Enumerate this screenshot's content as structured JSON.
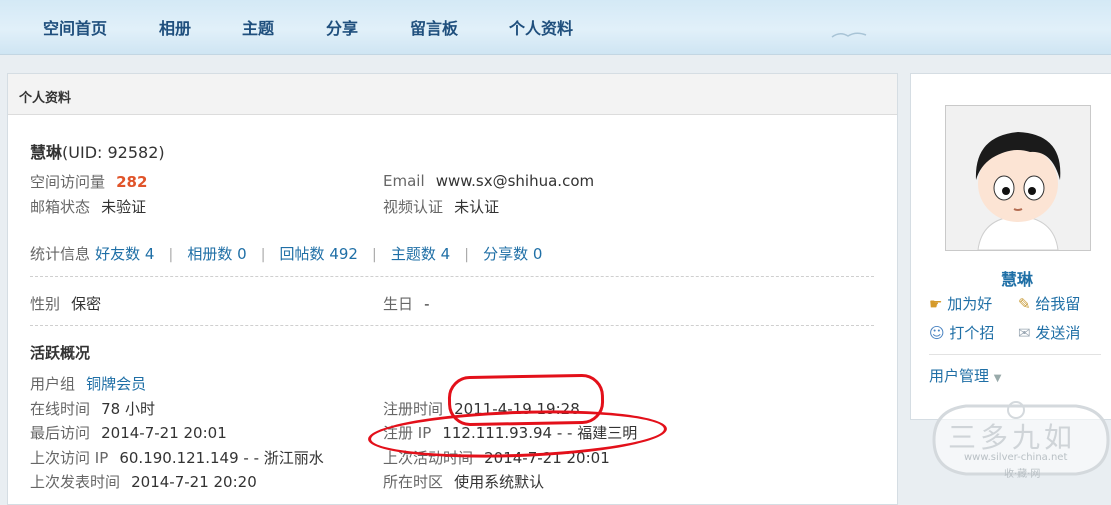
{
  "nav": {
    "items": [
      "空间首页",
      "相册",
      "主题",
      "分享",
      "留言板",
      "个人资料"
    ]
  },
  "panel": {
    "title": "个人资料"
  },
  "profile": {
    "name": "慧琳",
    "uid_text": "(UID: 92582)",
    "visits_label": "空间访问量",
    "visits_value": "282",
    "email_status_label": "邮箱状态",
    "email_status_value": "未验证",
    "email_label": "Email",
    "email_value": "www.sx@shihua.com",
    "video_label": "视频认证",
    "video_value": "未认证"
  },
  "stats": {
    "label": "统计信息",
    "items": [
      "好友数 4",
      "相册数 0",
      "回帖数 492",
      "主题数 4",
      "分享数 0"
    ]
  },
  "basic": {
    "gender_label": "性别",
    "gender_value": "保密",
    "birthday_label": "生日",
    "birthday_value": "-"
  },
  "activity": {
    "title": "活跃概况",
    "group_label": "用户组",
    "group_value": "铜牌会员",
    "online_label": "在线时间",
    "online_value": "78 小时",
    "last_visit_label": "最后访问",
    "last_visit_value": "2014-7-21 20:01",
    "last_ip_label": "上次访问 IP",
    "last_ip_value": "60.190.121.149 - - 浙江丽水",
    "last_post_label": "上次发表时间",
    "last_post_value": "2014-7-21 20:20",
    "reg_time_label": "注册时间",
    "reg_time_value": "2011-4-19 19:28",
    "reg_ip_label": "注册 IP",
    "reg_ip_value": "112.111.93.94 - - 福建三明",
    "last_active_label": "上次活动时间",
    "last_active_value": "2014-7-21 20:01",
    "timezone_label": "所在时区",
    "timezone_value": "使用系统默认"
  },
  "sidebar": {
    "name": "慧琳",
    "add_friend": "加为好",
    "leave_message": "给我留",
    "greet": "打个招",
    "send_message": "发送消",
    "user_manage": "用户管理"
  },
  "watermark": {
    "brand": "三多九如",
    "url": "www.silver-china.net",
    "sub": "收·藏·网"
  },
  "colors": {
    "link": "#1f6fa6",
    "nav_text": "#1f4f7d",
    "highlight": "#e0542a",
    "annotation": "#e3101a"
  }
}
